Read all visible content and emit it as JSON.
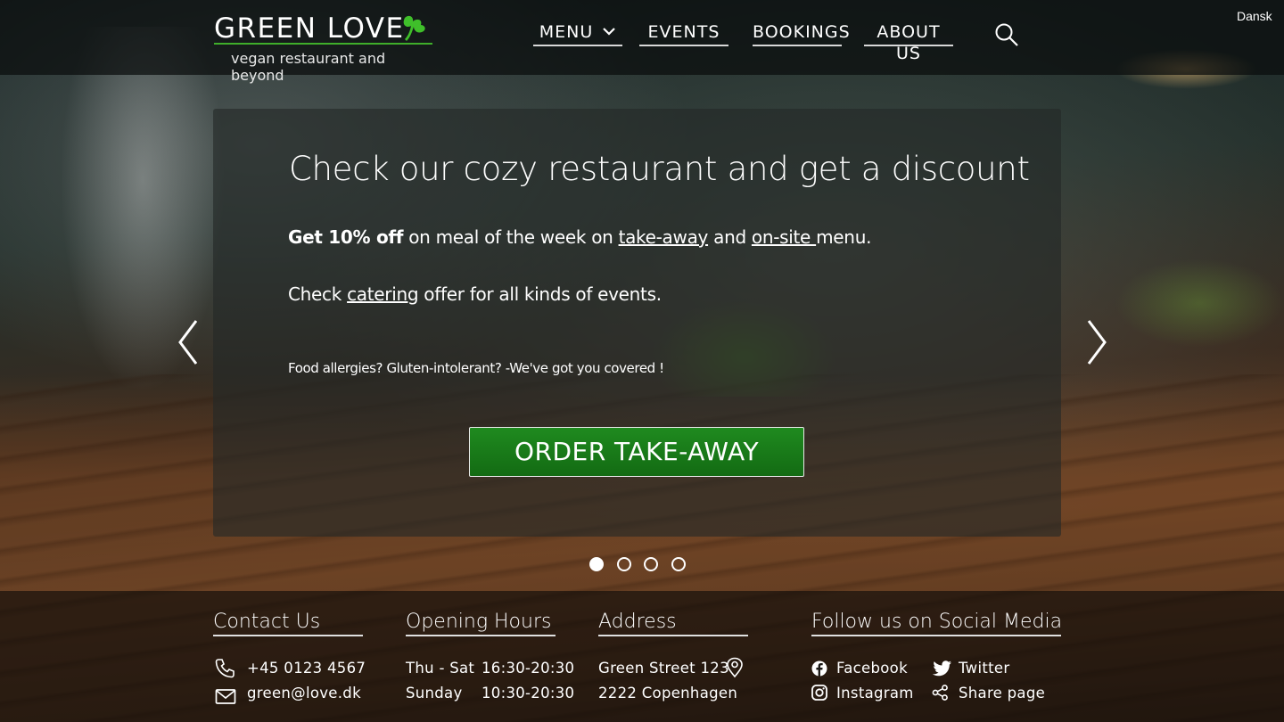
{
  "header": {
    "logo_title": "GREEN LOVE",
    "logo_subtitle": "vegan restaurant and beyond",
    "nav": [
      {
        "label": "MENU"
      },
      {
        "label": "EVENTS"
      },
      {
        "label": "BOOKINGS"
      },
      {
        "label": "ABOUT US"
      }
    ],
    "language": "Dansk"
  },
  "hero": {
    "title": "Check our cozy restaurant and get a discount",
    "line1_bold": "Get 10% off",
    "line1_a": " on meal of the week on ",
    "line1_link1": "take-away",
    "line1_b": " and ",
    "line1_link2": "on-site ",
    "line1_c": " menu.",
    "line2_a": "Check ",
    "line2_link": "catering",
    "line2_b": " offer for all kinds of events.",
    "small_text": "Food allergies? Gluten-intolerant? -We've got you covered !",
    "cta_label": "ORDER TAKE-AWAY",
    "slides_count": 4,
    "active_slide": 1
  },
  "footer": {
    "contact": {
      "heading": "Contact  Us",
      "phone": "+45 0123 4567",
      "email": "green@love.dk"
    },
    "hours": {
      "heading": "Opening Hours",
      "rows": [
        {
          "days": "Thu - Sat",
          "time": "16:30-20:30"
        },
        {
          "days": "Sunday",
          "time": "10:30-20:30"
        }
      ]
    },
    "address": {
      "heading": "Address",
      "street": "Green Street 123",
      "city": "2222 Copenhagen"
    },
    "social": {
      "heading": "Follow us on Social Media",
      "facebook": "Facebook",
      "twitter": "Twitter",
      "instagram": "Instagram",
      "share": "Share page"
    }
  },
  "colors": {
    "brand_green": "#3fae2a",
    "cta_green": "#1a7d1a"
  }
}
